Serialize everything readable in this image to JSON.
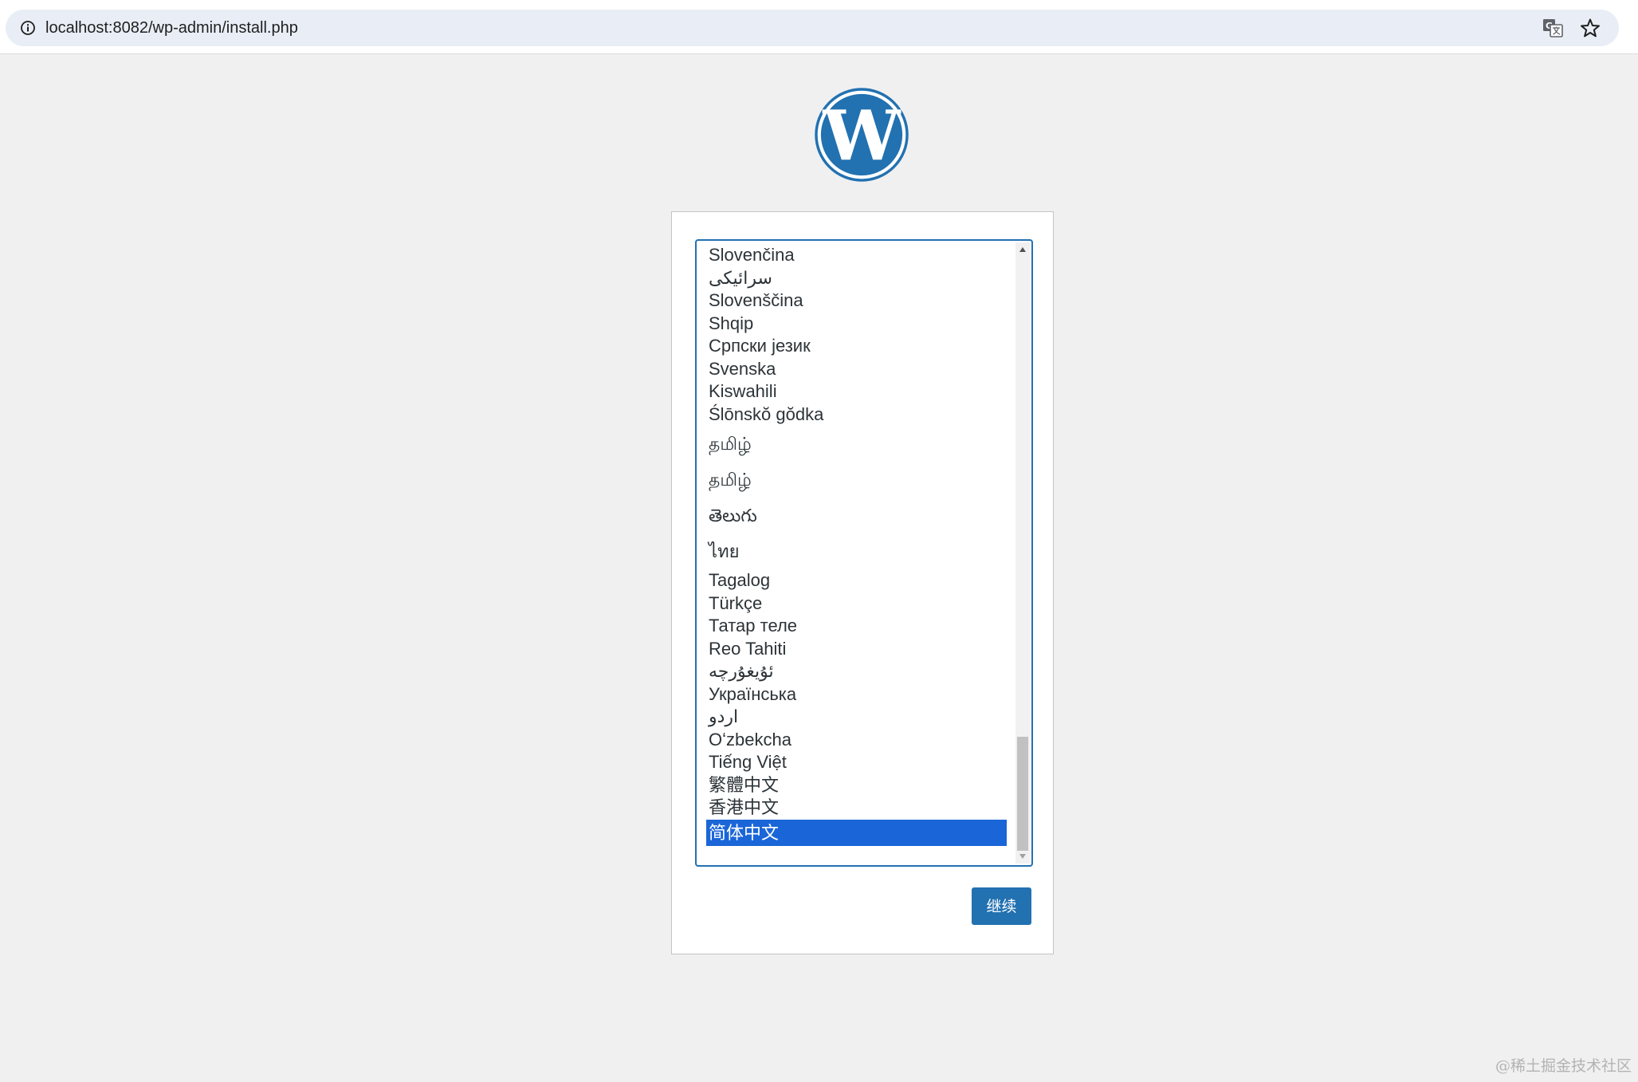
{
  "browser": {
    "url": "localhost:8082/wp-admin/install.php",
    "icons": {
      "site_info": "info-circle-icon",
      "translate": "translate-icon",
      "bookmark": "star-icon"
    }
  },
  "installer": {
    "logo": "wordpress-logo",
    "languages": [
      "Slovenčina",
      "سرائیکی",
      "Slovenščina",
      "Shqip",
      "Српски језик",
      "Svenska",
      "Kiswahili",
      "Ślōnskŏ gŏdka",
      "தமிழ்",
      "தமிழ்",
      "తెలుగు",
      "ไทย",
      "Tagalog",
      "Türkçe",
      "Татар теле",
      "Reo Tahiti",
      "ئۇيغۇرچە",
      "Українська",
      "اردو",
      "Oʻzbekcha",
      "Tiếng Việt",
      "繁體中文",
      "香港中文",
      "简体中文"
    ],
    "selected_language": "简体中文",
    "continue_label": "继续"
  },
  "colors": {
    "accent": "#2271b1",
    "selection": "#1a66d8",
    "page_background": "#f0f0f1"
  },
  "watermark": "@稀土掘金技术社区"
}
